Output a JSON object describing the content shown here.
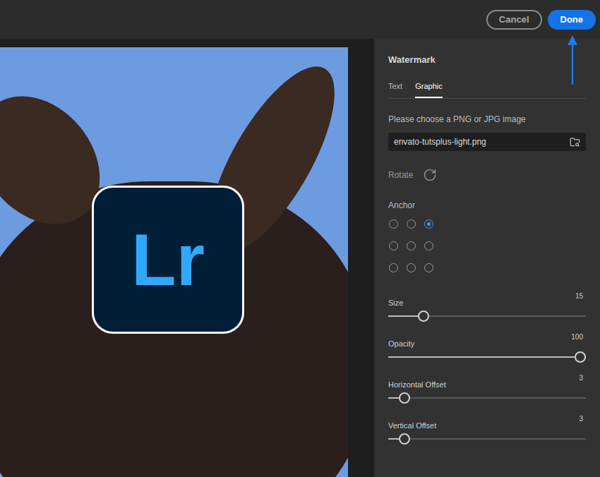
{
  "toolbar": {
    "buttons": [
      {
        "label": "Cancel",
        "primary": false
      },
      {
        "label": "Done",
        "primary": true
      }
    ]
  },
  "preview": {
    "watermark": "Lr"
  },
  "panel": {
    "title": "Watermark",
    "tabs": [
      {
        "label": "Text",
        "selected": false
      },
      {
        "label": "Graphic",
        "selected": true
      }
    ],
    "file_prompt": "Please choose a PNG or JPG image",
    "file": "envato-tutsplus-light.png",
    "rotate_label": "Rotate",
    "anchor_label": "Anchor",
    "anchors": [
      {
        "selected": false
      },
      {
        "selected": false
      },
      {
        "selected": true
      },
      {
        "selected": false
      },
      {
        "selected": false
      },
      {
        "selected": false
      },
      {
        "selected": false
      },
      {
        "selected": false
      },
      {
        "selected": false
      }
    ],
    "sliders": [
      {
        "label": "Size",
        "value": "15",
        "level": 0.16
      },
      {
        "label": "Opacity",
        "value": "100",
        "level": 1
      },
      {
        "label": "Horizontal Offset",
        "value": "3",
        "level": 0.058
      },
      {
        "label": "Vertical Offset",
        "value": "3",
        "level": 0.058
      }
    ]
  }
}
